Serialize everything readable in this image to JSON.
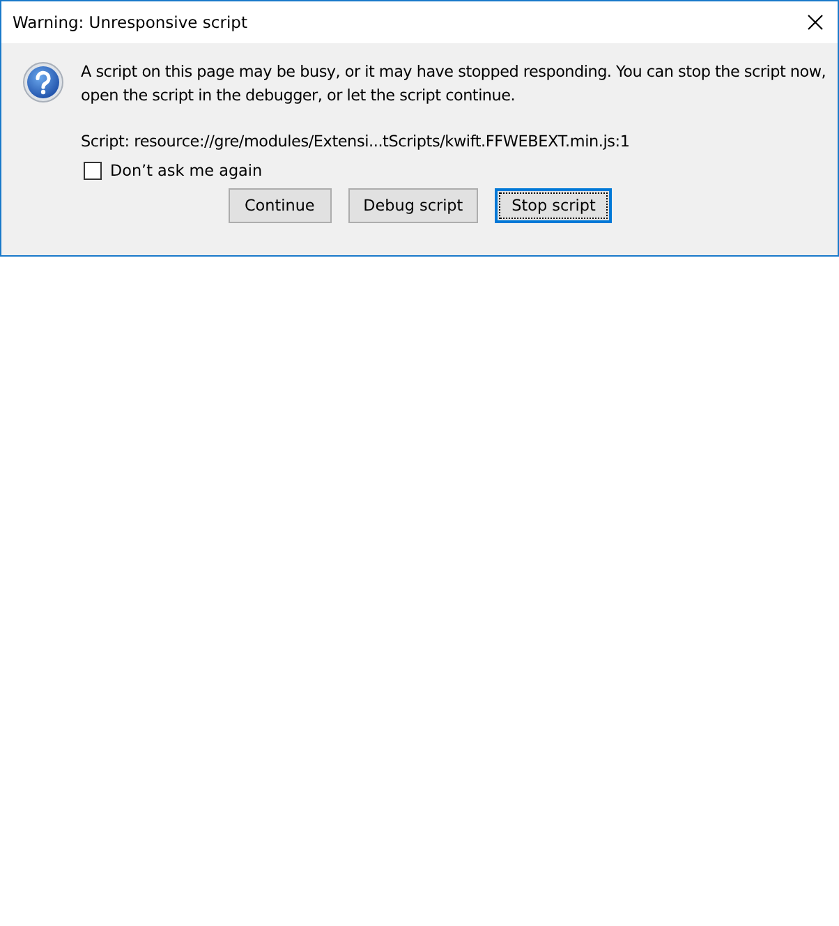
{
  "window": {
    "title": "Warning: Unresponsive script"
  },
  "message": "A script on this page may be busy, or it may have stopped responding. You can stop the script now, open the script in the debugger, or let the script continue.",
  "script_line": "Script: resource://gre/modules/Extensi...tScripts/kwift.FFWEBEXT.min.js:1",
  "checkbox": {
    "label": "Don’t ask me again",
    "checked": false
  },
  "buttons": [
    {
      "label": "Continue",
      "default": false
    },
    {
      "label": "Debug script",
      "default": false
    },
    {
      "label": "Stop script",
      "default": true
    }
  ]
}
